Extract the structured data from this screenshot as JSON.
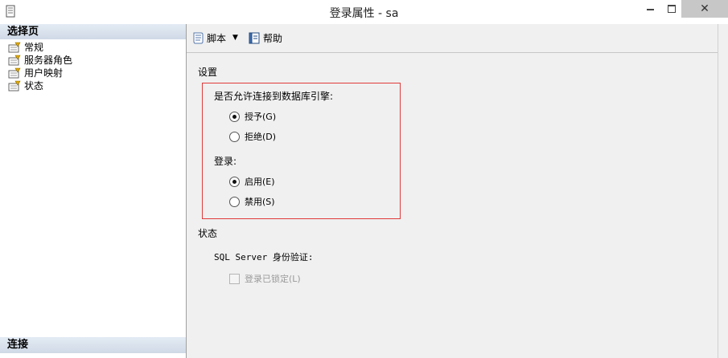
{
  "window": {
    "title": "登录属性 - sa"
  },
  "left_pane": {
    "header": "选择页",
    "pages": [
      {
        "label": "常规",
        "icon": "page-icon"
      },
      {
        "label": "服务器角色",
        "icon": "page-icon"
      },
      {
        "label": "用户映射",
        "icon": "page-icon"
      },
      {
        "label": "状态",
        "icon": "page-icon"
      }
    ],
    "connection_header": "连接"
  },
  "toolbar": {
    "script_label": "脚本",
    "help_label": "帮助"
  },
  "settings": {
    "section_title": "设置",
    "db_engine_label": "是否允许连接到数据库引擎:",
    "grant_label": "授予(G)",
    "deny_label": "拒绝(D)",
    "db_engine_selected": "grant",
    "login_label": "登录:",
    "enable_label": "启用(E)",
    "disable_label": "禁用(S)",
    "login_selected": "enable"
  },
  "status": {
    "section_title": "状态",
    "sql_auth_label": "SQL Server 身份验证:",
    "locked_label": "登录已锁定(L)",
    "locked_checked": false
  },
  "colors": {
    "highlight_border": "#e03a3a",
    "pane_header": "#d6dfea"
  }
}
